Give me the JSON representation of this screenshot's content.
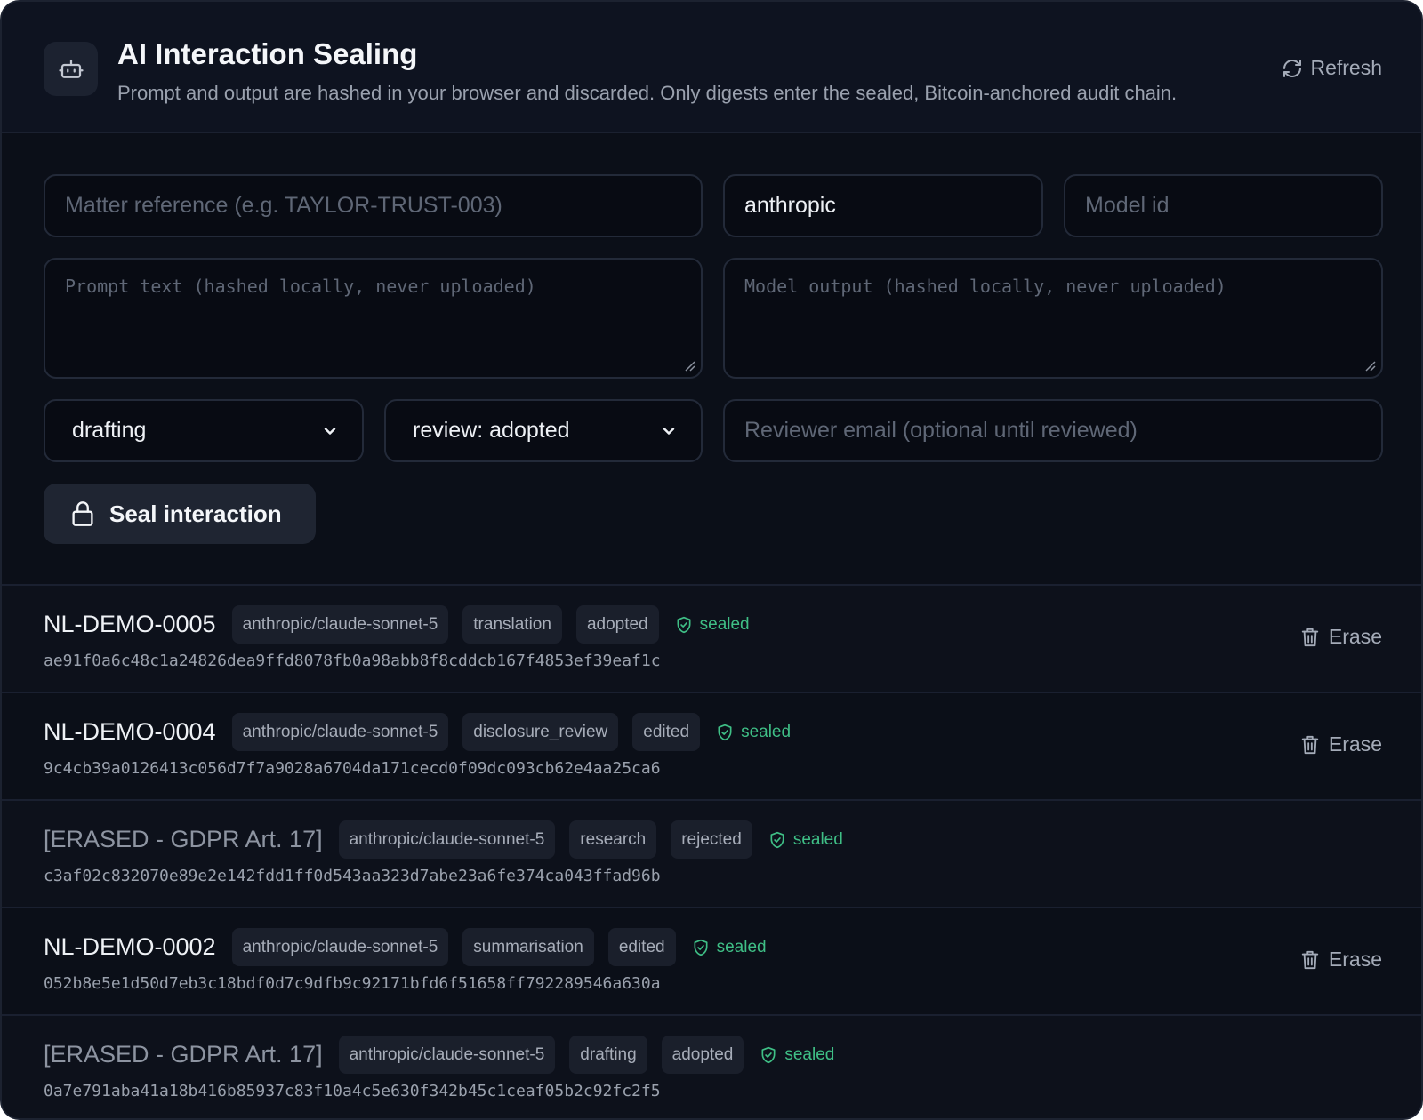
{
  "header": {
    "title": "AI Interaction Sealing",
    "subtitle": "Prompt and output are hashed in your browser and discarded. Only digests enter the sealed, Bitcoin-anchored audit chain.",
    "refresh_label": "Refresh",
    "icon": "robot-icon"
  },
  "form": {
    "matter_placeholder": "Matter reference (e.g. TAYLOR-TRUST-003)",
    "provider_value": "anthropic",
    "model_placeholder": "Model id",
    "prompt_placeholder": "Prompt text (hashed locally, never uploaded)",
    "output_placeholder": "Model output (hashed locally, never uploaded)",
    "purpose_value": "drafting",
    "review_value": "review: adopted",
    "reviewer_placeholder": "Reviewer email (optional until reviewed)",
    "seal_label": "Seal interaction"
  },
  "records": [
    {
      "ref": "NL-DEMO-0005",
      "model": "anthropic/claude-sonnet-5",
      "purpose": "translation",
      "review": "adopted",
      "status": "sealed",
      "hash": "ae91f0a6c48c1a24826dea9ffd8078fb0a98abb8f8cddcb167f4853ef39eaf1c",
      "erase_label": "Erase"
    },
    {
      "ref": "NL-DEMO-0004",
      "model": "anthropic/claude-sonnet-5",
      "purpose": "disclosure_review",
      "review": "edited",
      "status": "sealed",
      "hash": "9c4cb39a0126413c056d7f7a9028a6704da171cecd0f09dc093cb62e4aa25ca6",
      "erase_label": "Erase"
    },
    {
      "ref": "[ERASED - GDPR Art. 17]",
      "model": "anthropic/claude-sonnet-5",
      "purpose": "research",
      "review": "rejected",
      "status": "sealed",
      "hash": "c3af02c832070e89e2e142fdd1ff0d543aa323d7abe23a6fe374ca043ffad96b"
    },
    {
      "ref": "NL-DEMO-0002",
      "model": "anthropic/claude-sonnet-5",
      "purpose": "summarisation",
      "review": "edited",
      "status": "sealed",
      "hash": "052b8e5e1d50d7eb3c18bdf0d7c9dfb9c92171bfd6f51658ff792289546a630a",
      "erase_label": "Erase"
    },
    {
      "ref": "[ERASED - GDPR Art. 17]",
      "model": "anthropic/claude-sonnet-5",
      "purpose": "drafting",
      "review": "adopted",
      "status": "sealed",
      "hash": "0a7e791aba41a18b416b85937c83f10a4c5e630f342b45c1ceaf05b2c92fc2f5"
    }
  ],
  "colors": {
    "background": "#0b0f18",
    "sealed_green": "#3fbf86",
    "chip_bg": "#1a1f2b",
    "button_bg": "#1f2532"
  }
}
